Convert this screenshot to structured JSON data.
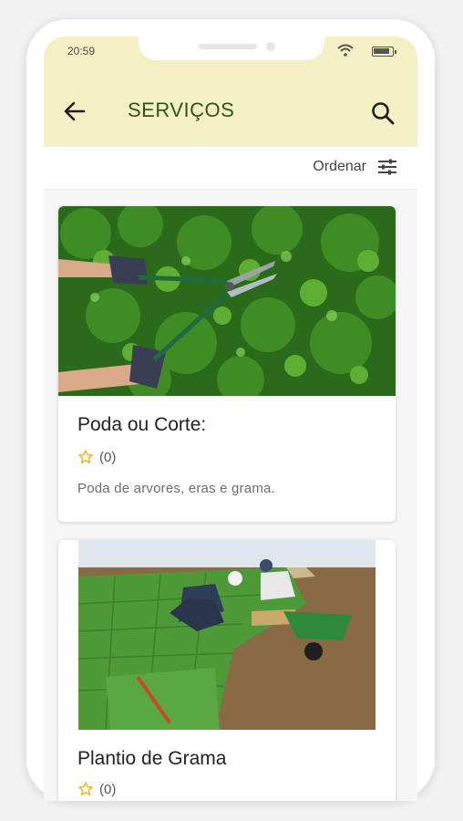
{
  "status_bar": {
    "time": "20:59"
  },
  "app_bar": {
    "title": "SERVIÇOS",
    "back_icon": "arrow-left-icon",
    "search_icon": "search-icon"
  },
  "sort": {
    "label": "Ordenar",
    "icon": "sliders-icon"
  },
  "services": [
    {
      "title": "Poda ou Corte:",
      "rating_count": "(0)",
      "description": "Poda de arvores, eras e grama.",
      "image": "hedge-trimming-photo"
    },
    {
      "title": "Plantio de Grama",
      "rating_count": "(0)",
      "description": "",
      "image": "grass-planting-photo"
    }
  ],
  "colors": {
    "app_bar_bg": "#f5efc6",
    "title_color": "#2f5618",
    "star_color": "#e8b82a"
  }
}
